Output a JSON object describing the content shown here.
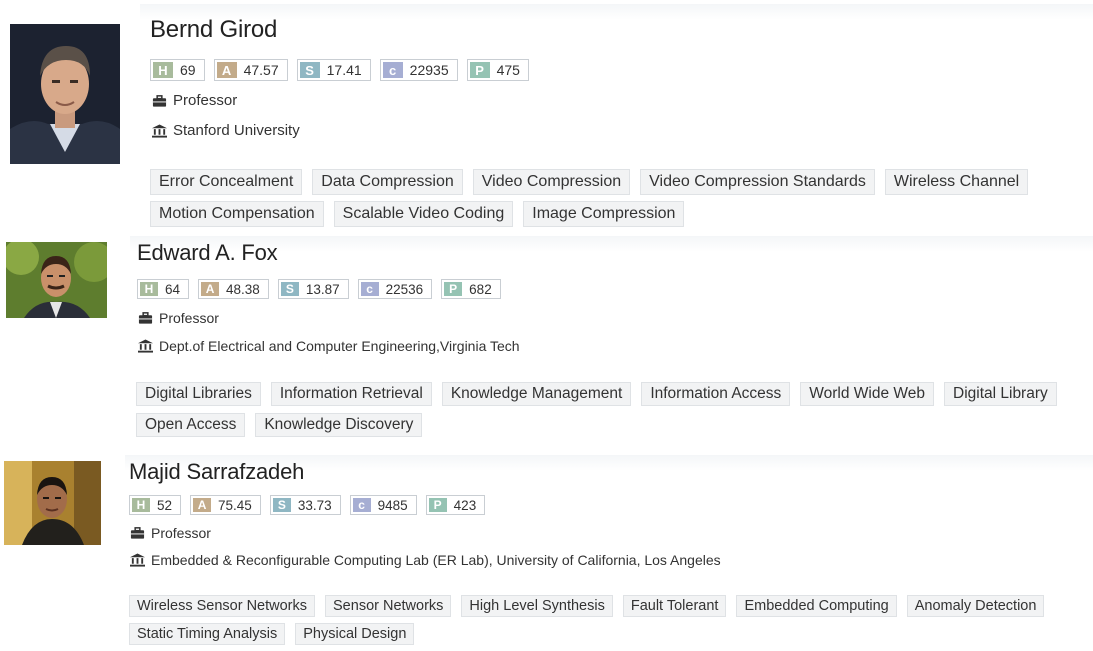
{
  "colors": {
    "H": "#a8bb9c",
    "A": "#c3ab8a",
    "S": "#8fb7c3",
    "C": "#a6aed3",
    "P": "#95c3b3"
  },
  "icons": {
    "position": "briefcase-icon",
    "affiliation": "institution-icon"
  },
  "people": [
    {
      "name": "Bernd Girod",
      "stats": {
        "h_label": "H",
        "h": "69",
        "a_label": "A",
        "a": "47.57",
        "s_label": "S",
        "s": "17.41",
        "c_label": "c",
        "c": "22935",
        "p_label": "P",
        "p": "475"
      },
      "position": "Professor",
      "affiliation": "Stanford University",
      "tags": [
        "Error Concealment",
        "Data Compression",
        "Video Compression",
        "Video Compression Standards",
        "Wireless Channel",
        "Motion Compensation",
        "Scalable Video Coding",
        "Image Compression"
      ]
    },
    {
      "name": "Edward A. Fox",
      "stats": {
        "h_label": "H",
        "h": "64",
        "a_label": "A",
        "a": "48.38",
        "s_label": "S",
        "s": "13.87",
        "c_label": "c",
        "c": "22536",
        "p_label": "P",
        "p": "682"
      },
      "position": "Professor",
      "affiliation": "Dept.of Electrical and Computer Engineering,Virginia Tech",
      "tags": [
        "Digital Libraries",
        "Information Retrieval",
        "Knowledge Management",
        "Information Access",
        "World Wide Web",
        "Digital Library",
        "Open Access",
        "Knowledge Discovery"
      ]
    },
    {
      "name": "Majid Sarrafzadeh",
      "stats": {
        "h_label": "H",
        "h": "52",
        "a_label": "A",
        "a": "75.45",
        "s_label": "S",
        "s": "33.73",
        "c_label": "c",
        "c": "9485",
        "p_label": "P",
        "p": "423"
      },
      "position": "Professor",
      "affiliation": "Embedded & Reconfigurable Computing Lab (ER Lab), University of California, Los Angeles",
      "tags": [
        "Wireless Sensor Networks",
        "Sensor Networks",
        "High Level Synthesis",
        "Fault Tolerant",
        "Embedded Computing",
        "Anomaly Detection",
        "Static Timing Analysis",
        "Physical Design"
      ]
    }
  ]
}
